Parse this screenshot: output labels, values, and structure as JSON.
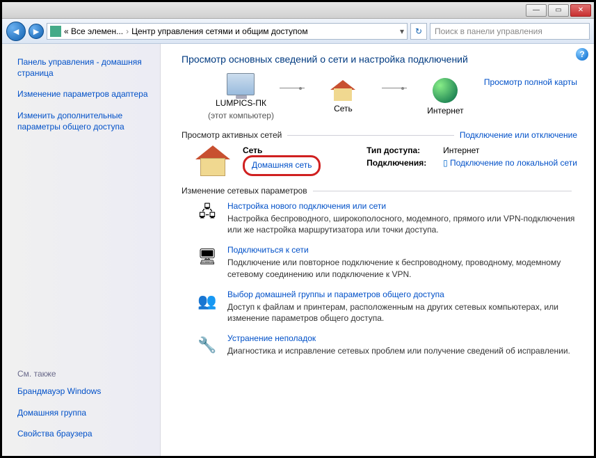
{
  "titlebar": {
    "min": "—",
    "max": "▭",
    "close": "✕"
  },
  "addrbar": {
    "bc_prefix": "« Все элемен...",
    "bc_current": "Центр управления сетями и общим доступом",
    "search_placeholder": "Поиск в панели управления"
  },
  "sidebar": {
    "home": "Панель управления - домашняя страница",
    "adapter": "Изменение параметров адаптера",
    "sharing": "Изменить дополнительные параметры общего доступа",
    "see_also_hdr": "См. также",
    "firewall": "Брандмауэр Windows",
    "homegroup": "Домашняя группа",
    "browser": "Свойства браузера"
  },
  "main": {
    "title": "Просмотр основных сведений о сети и настройка подключений",
    "full_map": "Просмотр полной карты",
    "node_pc": "LUMPICS-ПК",
    "node_pc_sub": "(этот компьютер)",
    "node_net": "Сеть",
    "node_inet": "Интернет",
    "active_hdr": "Просмотр активных сетей",
    "connect_link": "Подключение или отключение",
    "net_name": "Сеть",
    "net_type": "Домашняя сеть",
    "info_type_k": "Тип доступа:",
    "info_type_v": "Интернет",
    "info_conn_k": "Подключения:",
    "info_conn_v": "Подключение по локальной сети",
    "change_hdr": "Изменение сетевых параметров",
    "tasks": [
      {
        "title": "Настройка нового подключения или сети",
        "desc": "Настройка беспроводного, широкополосного, модемного, прямого или VPN-подключения или же настройка маршрутизатора или точки доступа."
      },
      {
        "title": "Подключиться к сети",
        "desc": "Подключение или повторное подключение к беспроводному, проводному, модемному сетевому соединению или подключение к VPN."
      },
      {
        "title": "Выбор домашней группы и параметров общего доступа",
        "desc": "Доступ к файлам и принтерам, расположенным на других сетевых компьютерах, или изменение параметров общего доступа."
      },
      {
        "title": "Устранение неполадок",
        "desc": "Диагностика и исправление сетевых проблем или получение сведений об исправлении."
      }
    ]
  }
}
